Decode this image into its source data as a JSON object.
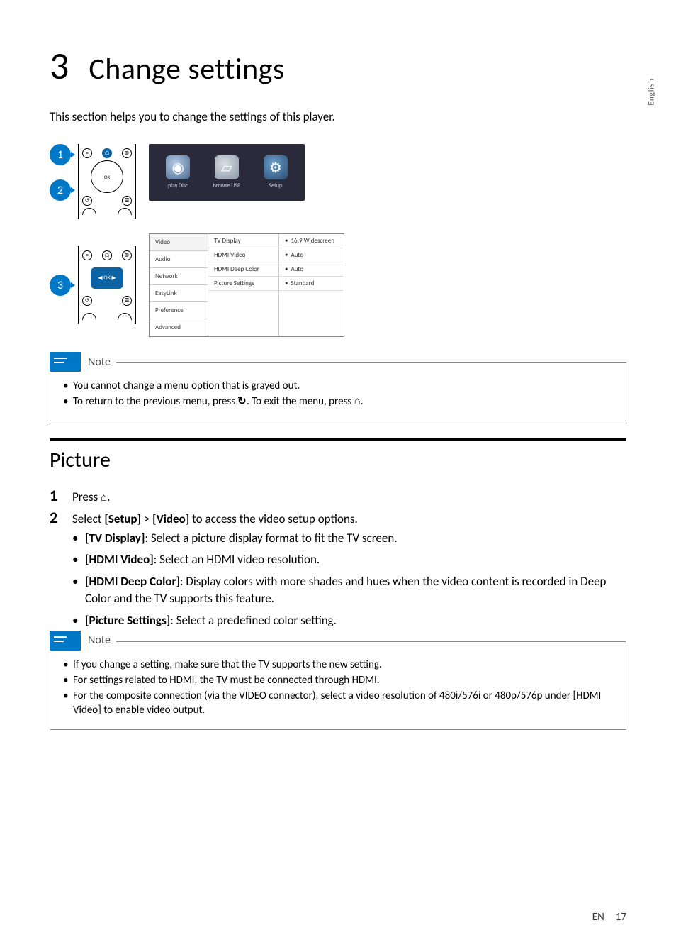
{
  "lang_side": "English",
  "chapter": {
    "num": "3",
    "title": "Change settings"
  },
  "intro": "This section helps you to change the settings of this player.",
  "bubbles": [
    "1",
    "2",
    "3"
  ],
  "home_menu": {
    "items": [
      {
        "label": "play Disc"
      },
      {
        "label": "browse USB"
      },
      {
        "label": "Setup"
      }
    ]
  },
  "settings_panel": {
    "tabs": [
      "Video",
      "Audio",
      "Network",
      "EasyLink",
      "Preference",
      "Advanced"
    ],
    "rows": [
      "TV Display",
      "HDMI Video",
      "HDMI Deep Color",
      "Picture Settings"
    ],
    "values": [
      "16:9 Widescreen",
      "Auto",
      "Auto",
      "Standard"
    ]
  },
  "note1": {
    "label": "Note",
    "items": [
      "You cannot change a menu option that is grayed out.",
      "To return to the previous menu, press BACK_GLYPH. To exit the menu, press HOME_GLYPH."
    ]
  },
  "section_title": "Picture",
  "step1": {
    "num": "1",
    "prefix": "Press ",
    "suffix": "."
  },
  "step2": {
    "num": "2",
    "prefix": "Select ",
    "b1": "[Setup]",
    "mid": " > ",
    "b2": "[Video]",
    "suffix": " to access the video setup options."
  },
  "picture_bullets": [
    {
      "b": "[TV Display]",
      "rest": ": Select a picture display format to fit the TV screen."
    },
    {
      "b": "[HDMI Video]",
      "rest": ": Select an HDMI video resolution."
    },
    {
      "b": "[HDMI Deep Color]",
      "rest": ": Display colors with more shades and hues when the video content is recorded in Deep Color and the TV supports this feature."
    },
    {
      "b": "[Picture Settings]",
      "rest": ": Select a predefined color setting."
    }
  ],
  "note2": {
    "label": "Note",
    "items": [
      "If you change a setting, make sure that the TV supports the new setting.",
      "For settings related to HDMI, the TV must be connected through HDMI.",
      {
        "pre": "For the composite connection (via the ",
        "b1": "VIDEO",
        "mid": " connector), select a video resolution of 480i/576i or 480p/576p under ",
        "b2": "[HDMI Video]",
        "post": " to enable video output."
      }
    ]
  },
  "footer": {
    "lang": "EN",
    "page": "17"
  }
}
